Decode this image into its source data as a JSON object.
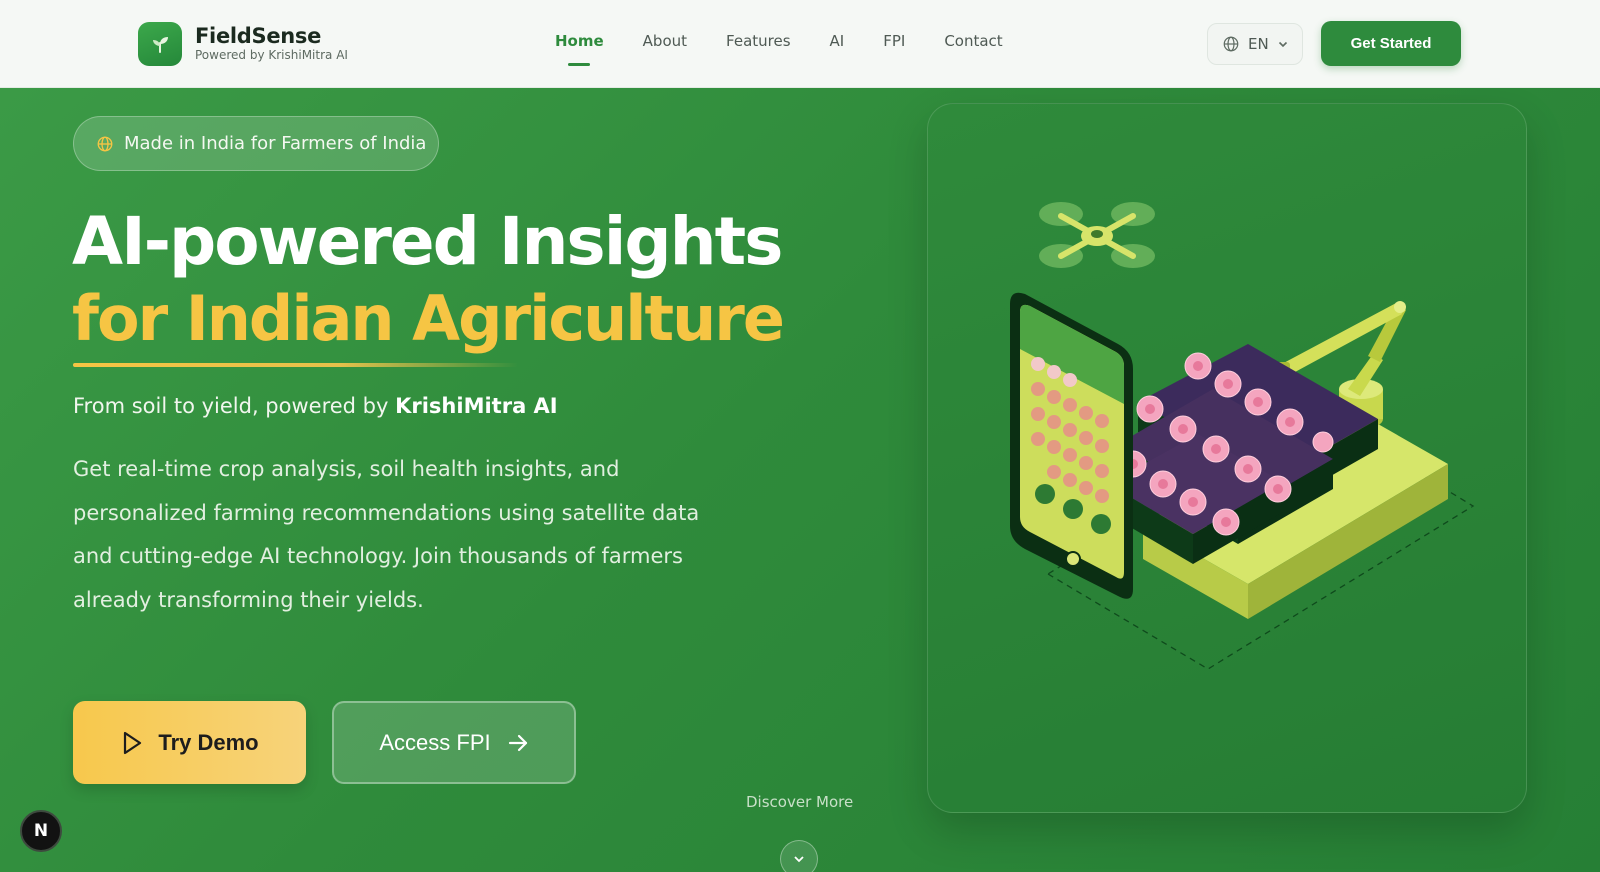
{
  "header": {
    "brand_name": "FieldSense",
    "brand_sub": "Powered by KrishiMitra AI",
    "nav": [
      {
        "label": "Home",
        "active": true
      },
      {
        "label": "About",
        "active": false
      },
      {
        "label": "Features",
        "active": false
      },
      {
        "label": "AI",
        "active": false
      },
      {
        "label": "FPI",
        "active": false
      },
      {
        "label": "Contact",
        "active": false
      }
    ],
    "language": "EN",
    "cta_label": "Get Started"
  },
  "hero": {
    "badge": "Made in India for Farmers of India",
    "headline_line1": "AI-powered Insights",
    "headline_line2": "for Indian Agriculture",
    "tagline_prefix": "From soil to yield, powered by ",
    "tagline_brand": "KrishiMitra AI",
    "description": "Get real-time crop analysis, soil health insights, and personalized farming recommendations using satellite data and cutting-edge AI technology. Join thousands of farmers already transforming their yields.",
    "primary_button": "Try Demo",
    "secondary_button": "Access FPI",
    "discover_label": "Discover More"
  },
  "dev_badge": "N",
  "colors": {
    "brand_green": "#2e8b3d",
    "hero_green": "#2f8b3b",
    "accent_yellow": "#f6c544"
  },
  "icons": {
    "logo": "sprout-icon",
    "language": "globe-icon",
    "badge": "globe-icon",
    "primary_button": "play-icon",
    "secondary_button": "arrow-right-icon",
    "discover": "chevron-down-icon"
  }
}
